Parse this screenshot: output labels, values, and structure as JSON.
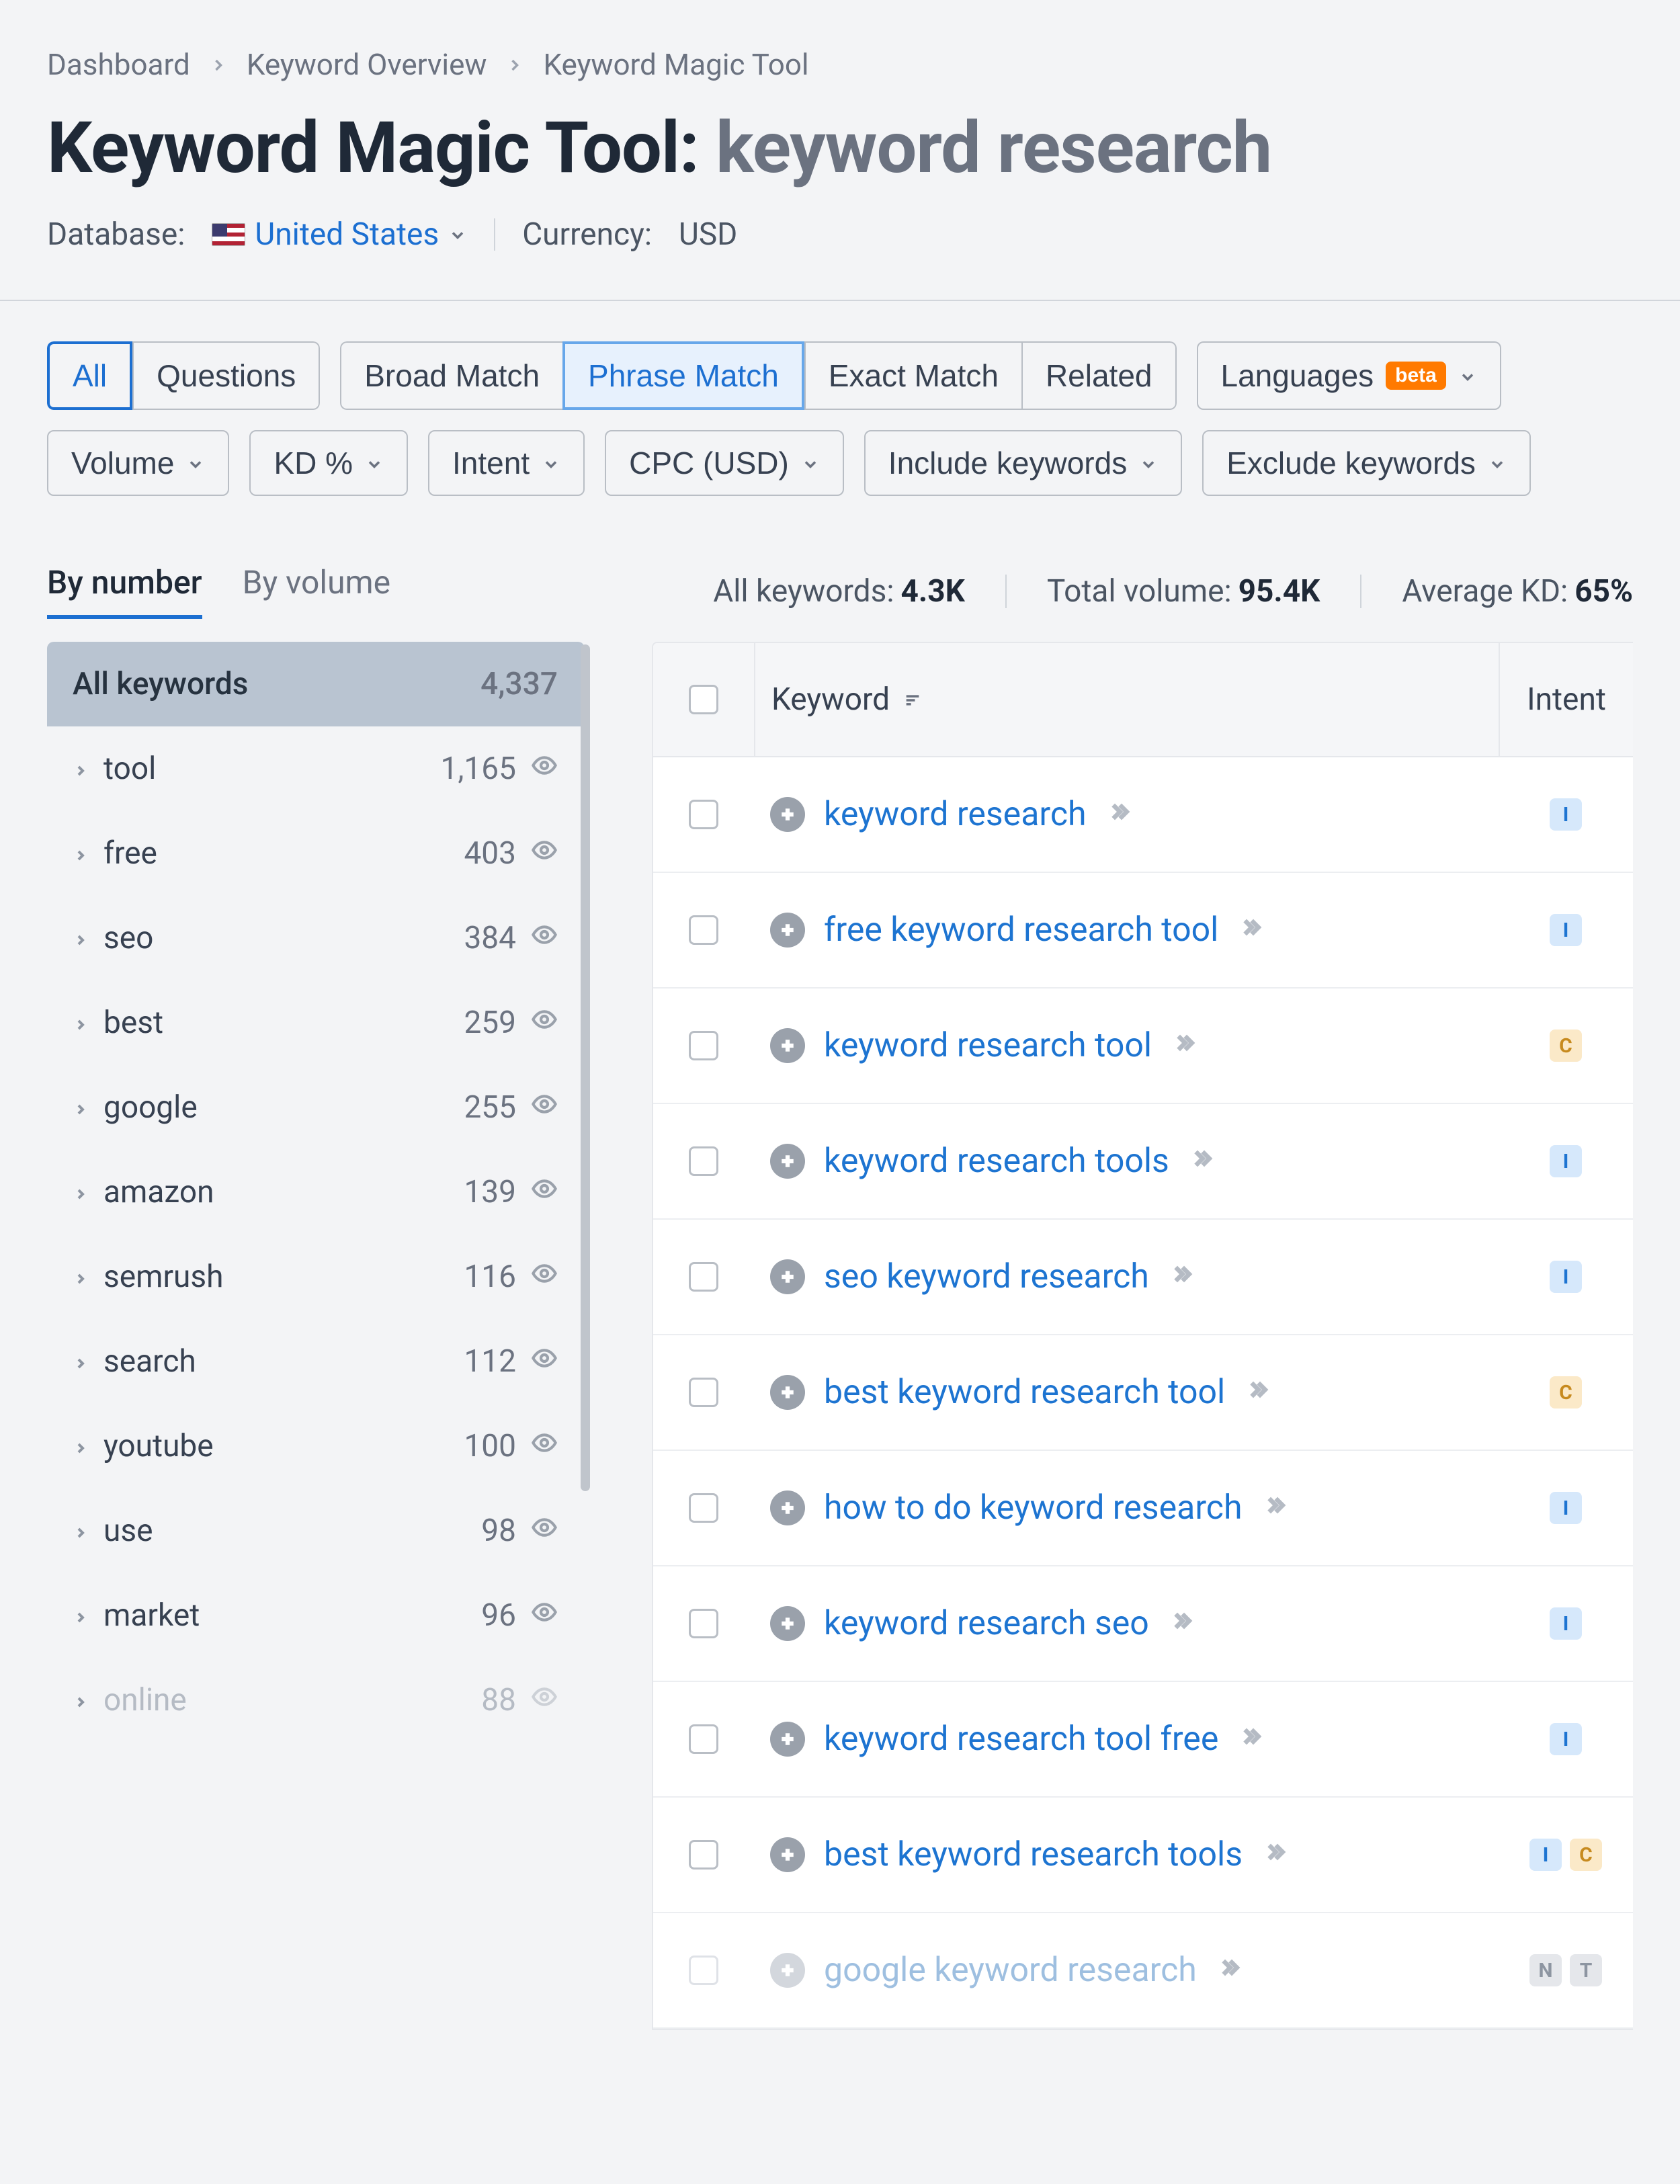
{
  "breadcrumb": [
    "Dashboard",
    "Keyword Overview",
    "Keyword Magic Tool"
  ],
  "title_prefix": "Keyword Magic Tool: ",
  "title_query": "keyword research",
  "database_label": "Database:",
  "database_value": "United States",
  "currency_label": "Currency:",
  "currency_value": "USD",
  "seg1": {
    "all": "All",
    "questions": "Questions"
  },
  "seg2": {
    "broad": "Broad Match",
    "phrase": "Phrase Match",
    "exact": "Exact Match",
    "related": "Related"
  },
  "languages_label": "Languages",
  "beta_label": "beta",
  "filters": {
    "volume": "Volume",
    "kd": "KD %",
    "intent": "Intent",
    "cpc": "CPC (USD)",
    "include": "Include keywords",
    "exclude": "Exclude keywords"
  },
  "tabs": {
    "by_number": "By number",
    "by_volume": "By volume"
  },
  "stats": {
    "all_label": "All keywords:",
    "all_value": "4.3K",
    "vol_label": "Total volume:",
    "vol_value": "95.4K",
    "kd_label": "Average KD:",
    "kd_value": "65%"
  },
  "sidebar_header": {
    "label": "All keywords",
    "count": "4,337"
  },
  "sidebar_items": [
    {
      "label": "tool",
      "count": "1,165"
    },
    {
      "label": "free",
      "count": "403"
    },
    {
      "label": "seo",
      "count": "384"
    },
    {
      "label": "best",
      "count": "259"
    },
    {
      "label": "google",
      "count": "255"
    },
    {
      "label": "amazon",
      "count": "139"
    },
    {
      "label": "semrush",
      "count": "116"
    },
    {
      "label": "search",
      "count": "112"
    },
    {
      "label": "youtube",
      "count": "100"
    },
    {
      "label": "use",
      "count": "98"
    },
    {
      "label": "market",
      "count": "96"
    },
    {
      "label": "online",
      "count": "88"
    }
  ],
  "table": {
    "header_keyword": "Keyword",
    "header_intent": "Intent",
    "rows": [
      {
        "keyword": "keyword research",
        "intents": [
          "I"
        ]
      },
      {
        "keyword": "free keyword research tool",
        "intents": [
          "I"
        ]
      },
      {
        "keyword": "keyword research tool",
        "intents": [
          "C"
        ]
      },
      {
        "keyword": "keyword research tools",
        "intents": [
          "I"
        ]
      },
      {
        "keyword": "seo keyword research",
        "intents": [
          "I"
        ]
      },
      {
        "keyword": "best keyword research tool",
        "intents": [
          "C"
        ]
      },
      {
        "keyword": "how to do keyword research",
        "intents": [
          "I"
        ]
      },
      {
        "keyword": "keyword research seo",
        "intents": [
          "I"
        ]
      },
      {
        "keyword": "keyword research tool free",
        "intents": [
          "I"
        ]
      },
      {
        "keyword": "best keyword research tools",
        "intents": [
          "I",
          "C"
        ]
      },
      {
        "keyword": "google keyword research",
        "intents": [
          "N",
          "T"
        ]
      }
    ]
  }
}
